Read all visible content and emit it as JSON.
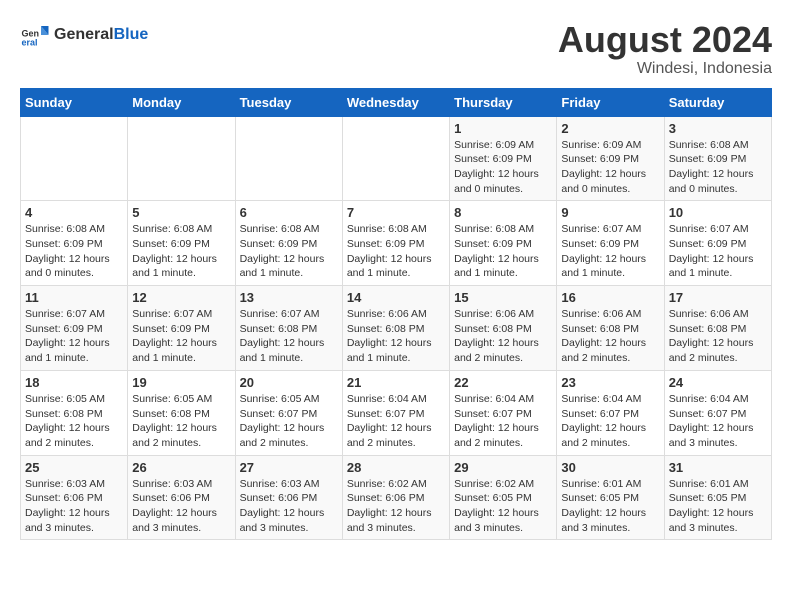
{
  "logo": {
    "general": "General",
    "blue": "Blue"
  },
  "header": {
    "title": "August 2024",
    "subtitle": "Windesi, Indonesia"
  },
  "days_of_week": [
    "Sunday",
    "Monday",
    "Tuesday",
    "Wednesday",
    "Thursday",
    "Friday",
    "Saturday"
  ],
  "weeks": [
    [
      {
        "day": "",
        "info": ""
      },
      {
        "day": "",
        "info": ""
      },
      {
        "day": "",
        "info": ""
      },
      {
        "day": "",
        "info": ""
      },
      {
        "day": "1",
        "info": "Sunrise: 6:09 AM\nSunset: 6:09 PM\nDaylight: 12 hours and 0 minutes."
      },
      {
        "day": "2",
        "info": "Sunrise: 6:09 AM\nSunset: 6:09 PM\nDaylight: 12 hours and 0 minutes."
      },
      {
        "day": "3",
        "info": "Sunrise: 6:08 AM\nSunset: 6:09 PM\nDaylight: 12 hours and 0 minutes."
      }
    ],
    [
      {
        "day": "4",
        "info": "Sunrise: 6:08 AM\nSunset: 6:09 PM\nDaylight: 12 hours and 0 minutes."
      },
      {
        "day": "5",
        "info": "Sunrise: 6:08 AM\nSunset: 6:09 PM\nDaylight: 12 hours and 1 minute."
      },
      {
        "day": "6",
        "info": "Sunrise: 6:08 AM\nSunset: 6:09 PM\nDaylight: 12 hours and 1 minute."
      },
      {
        "day": "7",
        "info": "Sunrise: 6:08 AM\nSunset: 6:09 PM\nDaylight: 12 hours and 1 minute."
      },
      {
        "day": "8",
        "info": "Sunrise: 6:08 AM\nSunset: 6:09 PM\nDaylight: 12 hours and 1 minute."
      },
      {
        "day": "9",
        "info": "Sunrise: 6:07 AM\nSunset: 6:09 PM\nDaylight: 12 hours and 1 minute."
      },
      {
        "day": "10",
        "info": "Sunrise: 6:07 AM\nSunset: 6:09 PM\nDaylight: 12 hours and 1 minute."
      }
    ],
    [
      {
        "day": "11",
        "info": "Sunrise: 6:07 AM\nSunset: 6:09 PM\nDaylight: 12 hours and 1 minute."
      },
      {
        "day": "12",
        "info": "Sunrise: 6:07 AM\nSunset: 6:09 PM\nDaylight: 12 hours and 1 minute."
      },
      {
        "day": "13",
        "info": "Sunrise: 6:07 AM\nSunset: 6:08 PM\nDaylight: 12 hours and 1 minute."
      },
      {
        "day": "14",
        "info": "Sunrise: 6:06 AM\nSunset: 6:08 PM\nDaylight: 12 hours and 1 minute."
      },
      {
        "day": "15",
        "info": "Sunrise: 6:06 AM\nSunset: 6:08 PM\nDaylight: 12 hours and 2 minutes."
      },
      {
        "day": "16",
        "info": "Sunrise: 6:06 AM\nSunset: 6:08 PM\nDaylight: 12 hours and 2 minutes."
      },
      {
        "day": "17",
        "info": "Sunrise: 6:06 AM\nSunset: 6:08 PM\nDaylight: 12 hours and 2 minutes."
      }
    ],
    [
      {
        "day": "18",
        "info": "Sunrise: 6:05 AM\nSunset: 6:08 PM\nDaylight: 12 hours and 2 minutes."
      },
      {
        "day": "19",
        "info": "Sunrise: 6:05 AM\nSunset: 6:08 PM\nDaylight: 12 hours and 2 minutes."
      },
      {
        "day": "20",
        "info": "Sunrise: 6:05 AM\nSunset: 6:07 PM\nDaylight: 12 hours and 2 minutes."
      },
      {
        "day": "21",
        "info": "Sunrise: 6:04 AM\nSunset: 6:07 PM\nDaylight: 12 hours and 2 minutes."
      },
      {
        "day": "22",
        "info": "Sunrise: 6:04 AM\nSunset: 6:07 PM\nDaylight: 12 hours and 2 minutes."
      },
      {
        "day": "23",
        "info": "Sunrise: 6:04 AM\nSunset: 6:07 PM\nDaylight: 12 hours and 2 minutes."
      },
      {
        "day": "24",
        "info": "Sunrise: 6:04 AM\nSunset: 6:07 PM\nDaylight: 12 hours and 3 minutes."
      }
    ],
    [
      {
        "day": "25",
        "info": "Sunrise: 6:03 AM\nSunset: 6:06 PM\nDaylight: 12 hours and 3 minutes."
      },
      {
        "day": "26",
        "info": "Sunrise: 6:03 AM\nSunset: 6:06 PM\nDaylight: 12 hours and 3 minutes."
      },
      {
        "day": "27",
        "info": "Sunrise: 6:03 AM\nSunset: 6:06 PM\nDaylight: 12 hours and 3 minutes."
      },
      {
        "day": "28",
        "info": "Sunrise: 6:02 AM\nSunset: 6:06 PM\nDaylight: 12 hours and 3 minutes."
      },
      {
        "day": "29",
        "info": "Sunrise: 6:02 AM\nSunset: 6:05 PM\nDaylight: 12 hours and 3 minutes."
      },
      {
        "day": "30",
        "info": "Sunrise: 6:01 AM\nSunset: 6:05 PM\nDaylight: 12 hours and 3 minutes."
      },
      {
        "day": "31",
        "info": "Sunrise: 6:01 AM\nSunset: 6:05 PM\nDaylight: 12 hours and 3 minutes."
      }
    ]
  ]
}
